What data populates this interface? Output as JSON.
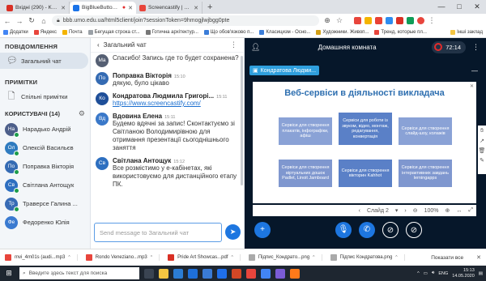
{
  "browser": {
    "tabs": [
      {
        "title": "Вхідні (290) - Kondratovaua@g",
        "favicon_color": "#d93025",
        "active": false
      },
      {
        "title": "BigBlueButton - Домашня",
        "favicon_color": "#1a73e8",
        "active": true
      },
      {
        "title": "Screencastify | The #1 Screen Re",
        "favicon_color": "#e8453c",
        "active": false
      }
    ],
    "new_tab": "+",
    "window_controls": {
      "minimize": "—",
      "maximize": "□",
      "close": "✕"
    },
    "url": "bbb.umo.edu.ua/html5client/join?sessionToken=9hmogjlwjbgg0pte",
    "bookmarks": [
      "Додатки",
      "Яндекс",
      "Почта",
      "Бегущая строка ст...",
      "Готична архітектур...",
      "Що обов'язково п...",
      "Класицизм - Осно...",
      "Художники. Живоп...",
      "Тренд, которые пл..."
    ],
    "other_bookmarks": "Інші заклад"
  },
  "sidebar": {
    "messages_title": "ПОВІДОМЛЕННЯ",
    "public_chat": "Загальний чат",
    "notes_title": "ПРИМІТКИ",
    "shared_notes": "Спільні примітки",
    "users_title": "КОРИСТУВАЧІ (14)",
    "users": [
      {
        "initials": "На",
        "name": "Нарадько Андрій",
        "color": "#4d5f8a"
      },
      {
        "initials": "Ол",
        "name": "Олексій Васильєв",
        "color": "#2f7bbf"
      },
      {
        "initials": "По",
        "name": "Поправка Вікторія",
        "color": "#356bb3"
      },
      {
        "initials": "Св",
        "name": "Світлана Антощук",
        "color": "#2d6fc0"
      },
      {
        "initials": "Тр",
        "name": "Траверсе Галина ...",
        "color": "#376bb5"
      },
      {
        "initials": "Фе",
        "name": "Федоренко Юлія",
        "color": "#3a7ad0"
      }
    ]
  },
  "chat": {
    "title": "Загальний чат",
    "messages": [
      {
        "initials": "Ма",
        "name": "",
        "time": "",
        "text": "Спасибо! Запись где то будет сохранена?",
        "color": "#555f73"
      },
      {
        "initials": "По",
        "name": "Поправка Вікторія",
        "time": "15:10",
        "text": "дякую, було цікаво",
        "color": "#356bb3"
      },
      {
        "initials": "Ко",
        "name": "Кондратова Людмила Григорі...",
        "time": "15:11",
        "text": "https://www.screencastify.com/",
        "link": true,
        "color": "#1f4f99"
      },
      {
        "initials": "Вд",
        "name": "Вдовина Елена",
        "time": "15:11",
        "text": "Будемо вдячні за запис! Сконтактуємо зі Світланою Володимирівною для отримання презентації сьогоднішнього заняття",
        "color": "#3a78c9"
      },
      {
        "initials": "Св",
        "name": "Світлана Антощук",
        "time": "15:12",
        "text": "Все розмістимо у е-кабінетах, які використовуємо для дистанційного етапу ПК.",
        "color": "#2d6fc0"
      }
    ],
    "input_placeholder": "Send message to Загальний чат"
  },
  "stage": {
    "title": "Домашняя комната",
    "timer": "72:14",
    "presenter": "Кондратова Людми...",
    "slide_title": "Веб-сервіси в діяльності викладача",
    "tiles": [
      "Сервіси для створення плакатів, інфографіки, афіш",
      "Сервіси для роботи із звуком, відео, монтаж, редагування, конвертація",
      "Сервіси для створення слайд-шоу, колажів",
      "Сервіси для створення віртуальних дошок Padlet, Linoit Jamboard",
      "Сервіси для створення вікторин Kahhot",
      "Сервіси для створення інтерактивних завдань lerningapps"
    ],
    "slide_label": "Слайд 2",
    "zoom": "100%"
  },
  "downloads": {
    "items": [
      "mvi_4m01s (audi...mp3",
      "Rondo Veneziano...mp3",
      "Pride Art Showcas...pdf",
      "Підпис_Кондрато...png",
      "Підпис Кондратова.png"
    ],
    "show_all": "Показати все"
  },
  "taskbar": {
    "search_placeholder": "Введите здесь текст для поиска",
    "lang": "ENG",
    "time": "15:13",
    "date": "14.05.2020"
  },
  "colors": {
    "accent": "#1d76e0",
    "stage_bg": "#06172a",
    "tile": "#7f97cf",
    "online": "#1c9c4b",
    "record": "#e22b2b"
  }
}
